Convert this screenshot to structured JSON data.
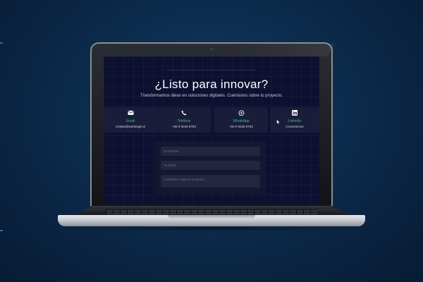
{
  "hero": {
    "title": "¿Listo para innovar?",
    "subtitle": "Transformamos ideas en soluciones digitales. Cuéntanos sobre tu proyecto."
  },
  "contacts": [
    {
      "icon": "email-icon",
      "label": "Email",
      "value": "cristian@webtinger.cl"
    },
    {
      "icon": "phone-icon",
      "label": "Teléfono",
      "value": "+56 9 9226 9783"
    },
    {
      "icon": "whatsapp-icon",
      "label": "WhatsApp",
      "value": "+56 9 9226 9783"
    },
    {
      "icon": "linkedin-icon",
      "label": "LinkedIn",
      "value": "Conectemos"
    }
  ],
  "form": {
    "name_placeholder": "Tu nombre",
    "email_placeholder": "Tu email",
    "message_placeholder": "Cuéntanos sobre tu proyecto..."
  },
  "colors": {
    "background": "#0b2847",
    "screen": "#0d1030",
    "card": "#1a1d3a",
    "accent": "#2cc08a"
  }
}
